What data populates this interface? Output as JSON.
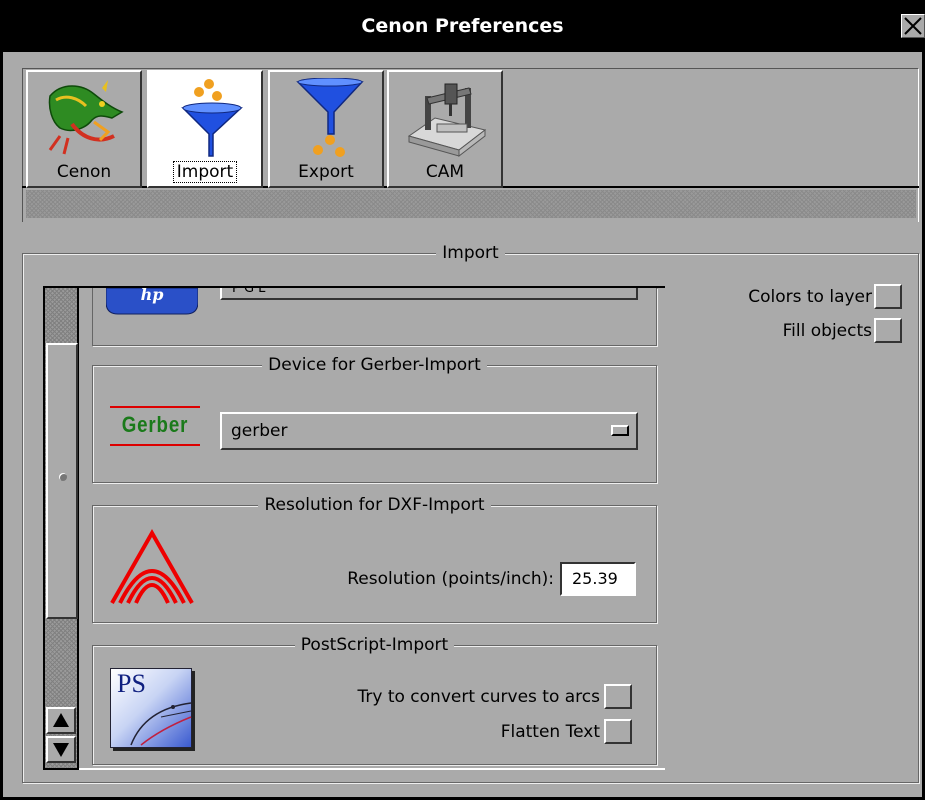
{
  "window": {
    "title": "Cenon Preferences"
  },
  "tabs": [
    {
      "label": "Cenon",
      "icon": "dragon-icon"
    },
    {
      "label": "Import",
      "icon": "funnel-in-icon",
      "selected": true
    },
    {
      "label": "Export",
      "icon": "funnel-out-icon"
    },
    {
      "label": "CAM",
      "icon": "milling-machine-icon"
    }
  ],
  "import": {
    "title": "Import",
    "hpgl_field_partial": "P G L",
    "gerber_section": {
      "title": "Device for Gerber-Import",
      "logo_text": "Gerber",
      "device": "gerber"
    },
    "dxf_section": {
      "title": "Resolution for DXF-Import",
      "resolution_label": "Resolution (points/inch):",
      "resolution_value": "25.39"
    },
    "ps_section": {
      "title": "PostScript-Import",
      "logo_text": "PS",
      "convert_arcs_label": "Try to convert curves to arcs",
      "flatten_text_label": "Flatten Text"
    },
    "colors_to_layer_label": "Colors to layer",
    "fill_objects_label": "Fill objects"
  },
  "colors": {
    "titlebar": "#000000",
    "background": "#aaaaaa",
    "gerber_green": "#1a7a1a",
    "dxf_red": "#ee0000",
    "hp_blue": "#2a50c8"
  }
}
